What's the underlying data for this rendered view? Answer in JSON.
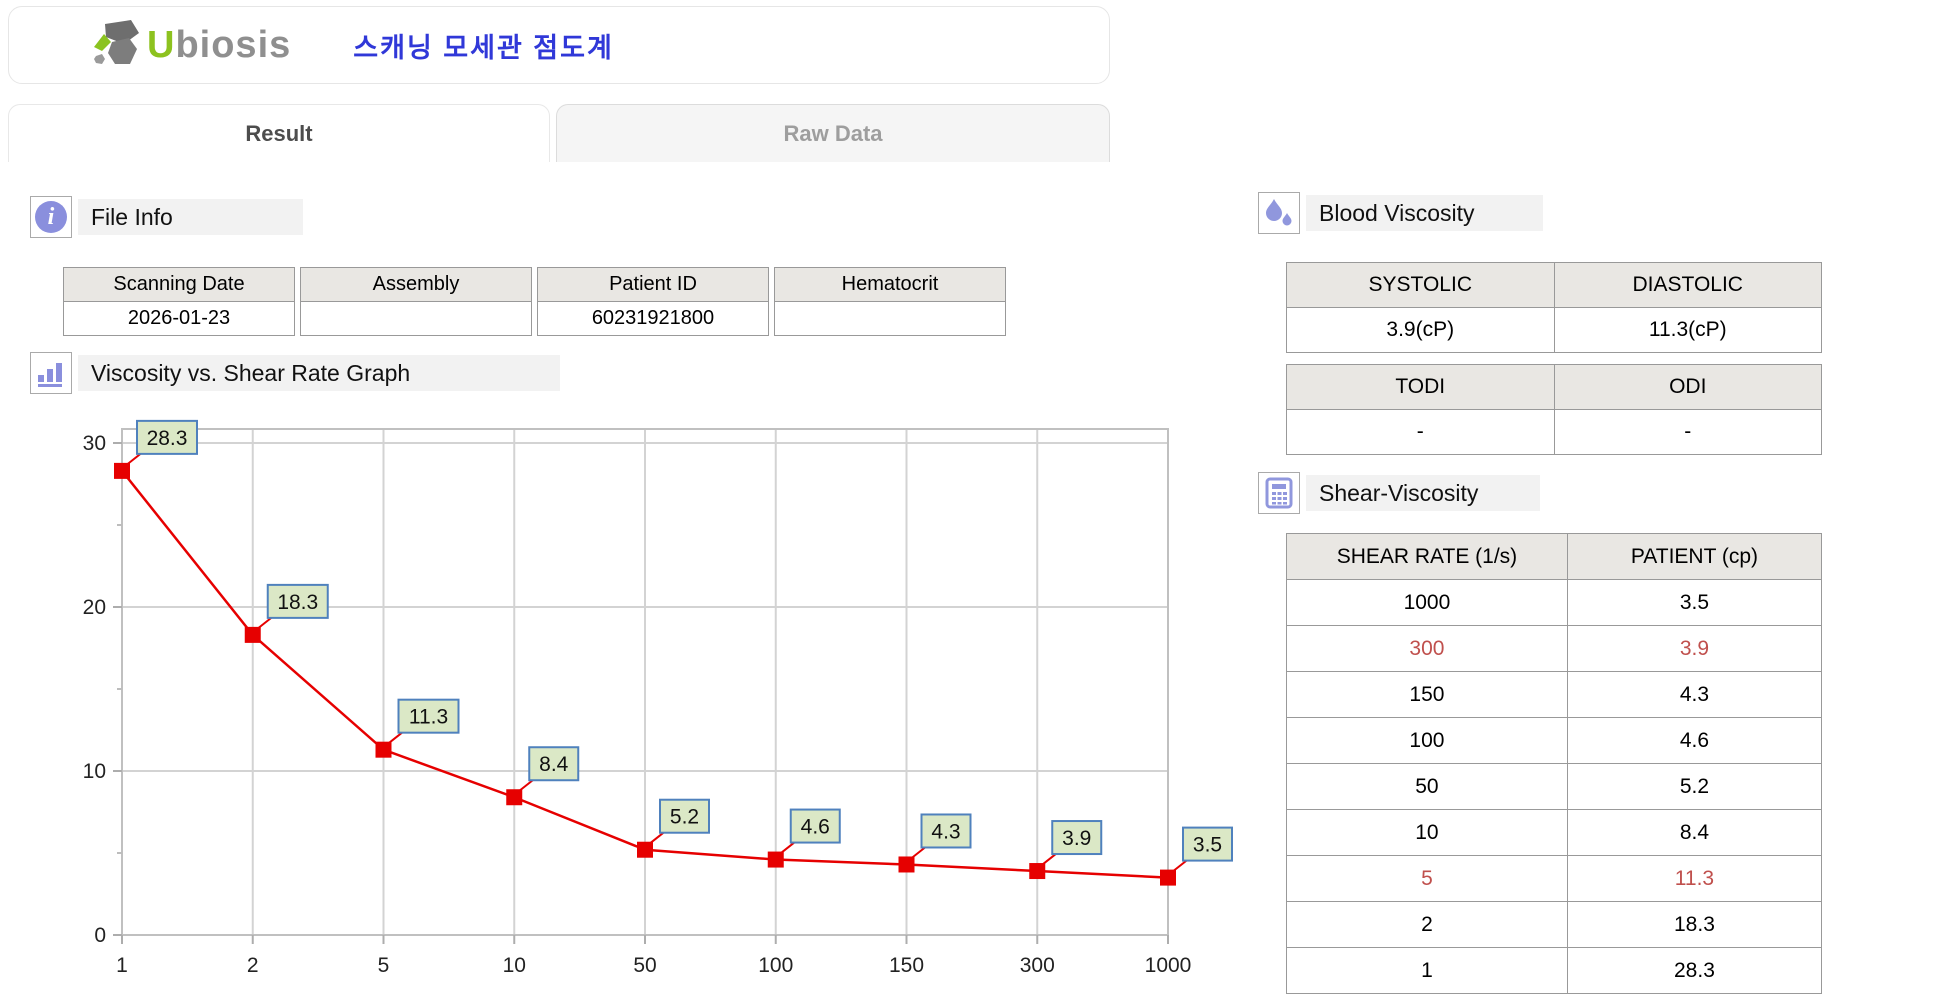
{
  "header": {
    "brand_u": "U",
    "brand_rest": "biosis",
    "korean_title": "스캐닝 모세관 점도계"
  },
  "tabs": [
    {
      "label": "Result",
      "active": true
    },
    {
      "label": "Raw Data",
      "active": false
    }
  ],
  "file_info": {
    "section_title": "File Info",
    "fields": [
      {
        "label": "Scanning Date",
        "value": "2026-01-23"
      },
      {
        "label": "Assembly",
        "value": ""
      },
      {
        "label": "Patient ID",
        "value": "60231921800"
      },
      {
        "label": "Hematocrit",
        "value": ""
      }
    ]
  },
  "graph_section": {
    "section_title": "Viscosity vs. Shear Rate Graph"
  },
  "chart_data": {
    "type": "line",
    "title": "Viscosity vs. Shear Rate Graph",
    "x_categories": [
      "1",
      "2",
      "5",
      "10",
      "50",
      "100",
      "150",
      "300",
      "1000"
    ],
    "values": [
      28.3,
      18.3,
      11.3,
      8.4,
      5.2,
      4.6,
      4.3,
      3.9,
      3.5
    ],
    "ylim": [
      0,
      30
    ],
    "yticks": [
      0,
      10,
      20,
      30
    ],
    "grid": true,
    "line_color": "#e60000",
    "marker": "square",
    "label_bg": "#dbe8c6",
    "label_border": "#4f81bd"
  },
  "blood_viscosity": {
    "section_title": "Blood Viscosity",
    "table1": {
      "headers": [
        "SYSTOLIC",
        "DIASTOLIC"
      ],
      "values": [
        "3.9(cP)",
        "11.3(cP)"
      ]
    },
    "table2": {
      "headers": [
        "TODI",
        "ODI"
      ],
      "values": [
        "-",
        "-"
      ]
    }
  },
  "shear_viscosity": {
    "section_title": "Shear-Viscosity",
    "headers": [
      "SHEAR RATE (1/s)",
      "PATIENT (cp)"
    ],
    "highlight_color": "#c0504d",
    "rows": [
      {
        "shear_rate": "1000",
        "patient": "3.5",
        "highlight": false
      },
      {
        "shear_rate": "300",
        "patient": "3.9",
        "highlight": true
      },
      {
        "shear_rate": "150",
        "patient": "4.3",
        "highlight": false
      },
      {
        "shear_rate": "100",
        "patient": "4.6",
        "highlight": false
      },
      {
        "shear_rate": "50",
        "patient": "5.2",
        "highlight": false
      },
      {
        "shear_rate": "10",
        "patient": "8.4",
        "highlight": false
      },
      {
        "shear_rate": "5",
        "patient": "11.3",
        "highlight": true
      },
      {
        "shear_rate": "2",
        "patient": "18.3",
        "highlight": false
      },
      {
        "shear_rate": "1",
        "patient": "28.3",
        "highlight": false
      }
    ]
  }
}
